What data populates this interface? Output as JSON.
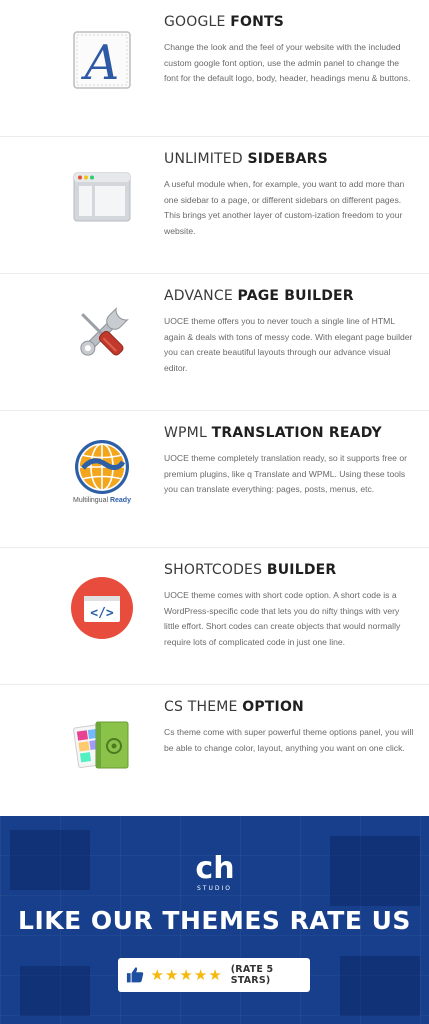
{
  "features": [
    {
      "icon": "font-letter-a-icon",
      "title_light": "GOOGLE ",
      "title_bold": "FONTS",
      "description": "Change the look and the feel of your website with the included custom google font option, use the admin panel to change the font for the default logo, body, header, headings menu & buttons."
    },
    {
      "icon": "sidebar-layout-icon",
      "title_light": "UNLIMITED ",
      "title_bold": "SIDEBARS",
      "description": "A useful module when, for example, you want to add more than one sidebar to a page, or different sidebars on different pages. This brings yet another layer of custom-ization freedom to your website."
    },
    {
      "icon": "wrench-screwdriver-icon",
      "title_light": "ADVANCE ",
      "title_bold": "PAGE BUILDER",
      "description": "UOCE theme offers you to never touch a single line of HTML again & deals with tons of messy code. With elegant page builder you can create beautiful layouts through our advance visual editor."
    },
    {
      "icon": "globe-icon",
      "icon_caption_light": "Multilingual ",
      "icon_caption_bold": "Ready",
      "title_light": "WPML ",
      "title_bold": "TRANSLATION READY",
      "description": "UOCE theme completely translation ready, so it supports free or premium plugins, like q Translate and WPML. Using these tools you can translate everything: pages, posts, menus, etc."
    },
    {
      "icon": "code-brackets-icon",
      "title_light": "SHORTCODES ",
      "title_bold": "BUILDER",
      "description": "UOCE theme comes with short code option. A short code is a WordPress-specific code that lets you do nifty things with very little effort. Short codes can create objects that would normally require lots of complicated code in just one line."
    },
    {
      "icon": "color-swatch-book-icon",
      "title_light": "CS THEME ",
      "title_bold": "OPTION",
      "description": "Cs theme come with super powerful theme options panel, you will be able to change color, layout, anything you want on one click."
    }
  ],
  "banner": {
    "logo_text": "ch",
    "studio_text": "STUDIO",
    "heading": "LIKE OUR THEMES RATE US",
    "rating": 5,
    "rate_label": "(RATE 5 STARS)",
    "background_color": "#173f8c",
    "star_color": "#f5b90f"
  }
}
